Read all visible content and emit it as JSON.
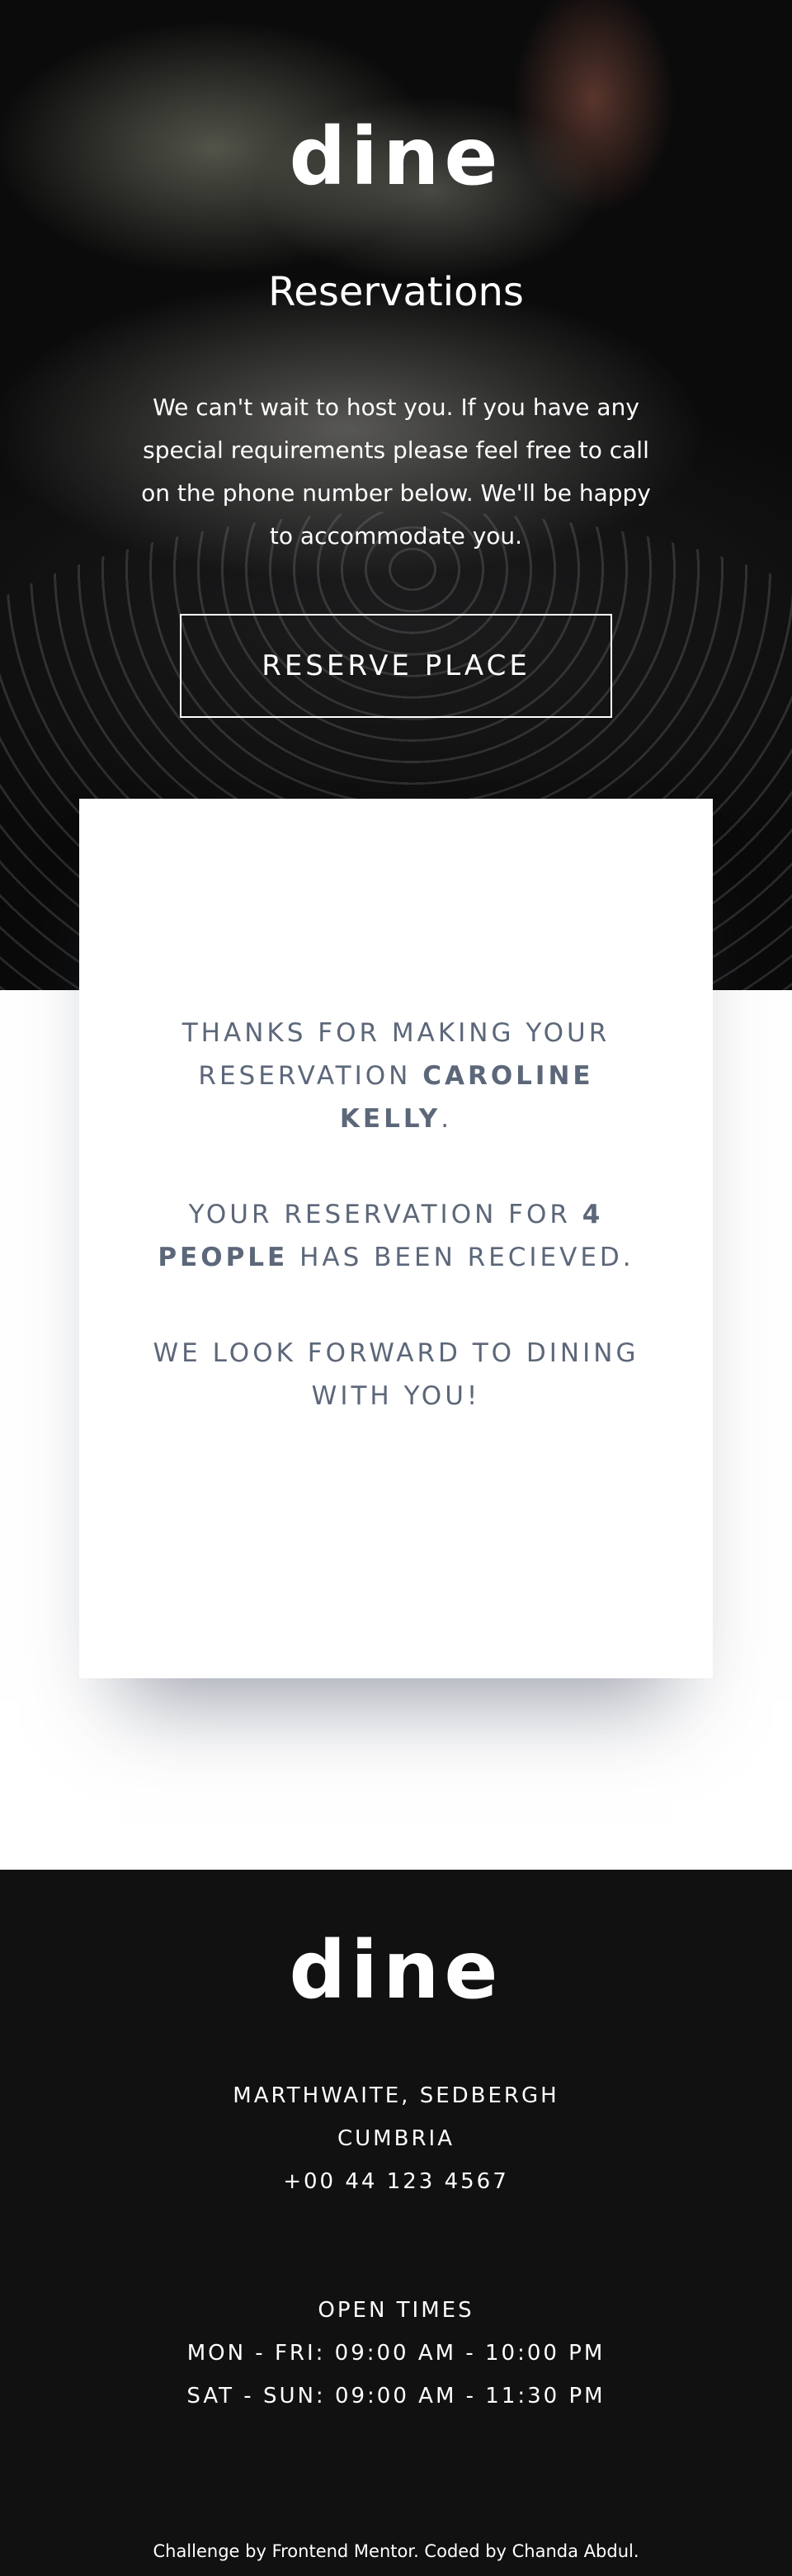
{
  "brand": {
    "logo_text": "dine"
  },
  "hero": {
    "title": "Reservations",
    "text": "We can't wait to host you. If you have any special requirements please feel free to call on the phone number below. We'll be happy to accommodate you.",
    "reserve_button_label": "RESERVE PLACE"
  },
  "confirmation": {
    "line1_prefix": "THANKS FOR MAKING YOUR RESERVATION ",
    "guest_name": "CAROLINE KELLY",
    "line1_suffix": ".",
    "line2_prefix": "YOUR RESERVATION FOR ",
    "party_size": "4 PEOPLE",
    "line2_suffix": " HAS BEEN RECIEVED.",
    "line3": "WE LOOK FORWARD TO DINING WITH YOU!"
  },
  "footer": {
    "logo_text": "dine",
    "address": {
      "line1": "MARTHWAITE, SEDBERGH",
      "line2": "CUMBRIA",
      "phone": "+00 44 123 4567"
    },
    "hours": {
      "heading": "OPEN TIMES",
      "weekdays": "MON - FRI: 09:00 AM - 10:00 PM",
      "weekend": "SAT - SUN: 09:00 AM - 11:30 PM"
    },
    "credit": {
      "prefix": "Challenge by ",
      "mentor_link": "Frontend Mentor",
      "middle": ". Coded by ",
      "author_link": "Chanda Abdul",
      "suffix": "."
    }
  },
  "colors": {
    "card_text": "#5c6779",
    "footer_bg": "#111111",
    "white": "#ffffff"
  }
}
